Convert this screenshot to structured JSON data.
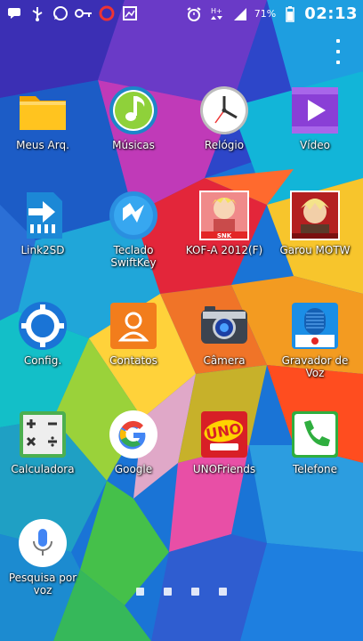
{
  "status_bar": {
    "battery_percent": "71%",
    "time": "02:13",
    "left_icons": [
      "message-icon",
      "usb-icon",
      "whatsapp-icon",
      "key-icon",
      "record-icon",
      "gallery-icon"
    ],
    "right_icons": [
      "alarm-icon",
      "hplus-icon",
      "signal-icon",
      "battery-icon"
    ]
  },
  "apps": [
    {
      "id": "meus-arq",
      "label": "Meus Arq.",
      "icon": "folder-icon"
    },
    {
      "id": "musicas",
      "label": "Músicas",
      "icon": "music-icon"
    },
    {
      "id": "relogio",
      "label": "Relógio",
      "icon": "clock-icon"
    },
    {
      "id": "video",
      "label": "Vídeo",
      "icon": "video-icon"
    },
    {
      "id": "link2sd",
      "label": "Link2SD",
      "icon": "link2sd-icon"
    },
    {
      "id": "teclado",
      "label": "Teclado SwiftKey",
      "icon": "swiftkey-icon"
    },
    {
      "id": "kof",
      "label": "KOF-A 2012(F)",
      "icon": "kof-icon"
    },
    {
      "id": "garou",
      "label": "Garou MOTW",
      "icon": "garou-icon"
    },
    {
      "id": "config",
      "label": "Config.",
      "icon": "settings-icon"
    },
    {
      "id": "contatos",
      "label": "Contatos",
      "icon": "contacts-icon"
    },
    {
      "id": "camera",
      "label": "Câmera",
      "icon": "camera-icon"
    },
    {
      "id": "gravador",
      "label": "Gravador de Voz",
      "icon": "voice-recorder-icon"
    },
    {
      "id": "calculadora",
      "label": "Calculadora",
      "icon": "calculator-icon"
    },
    {
      "id": "google",
      "label": "Google",
      "icon": "google-icon"
    },
    {
      "id": "unofriends",
      "label": "UNOFriends",
      "icon": "uno-icon"
    },
    {
      "id": "telefone",
      "label": "Telefone",
      "icon": "phone-icon"
    },
    {
      "id": "pesquisa",
      "label": "Pesquisa por voz",
      "icon": "microphone-icon"
    }
  ],
  "page_indicator": {
    "pages": 4
  },
  "icon_text": {
    "snk": "SNK",
    "uno": "UNO"
  }
}
